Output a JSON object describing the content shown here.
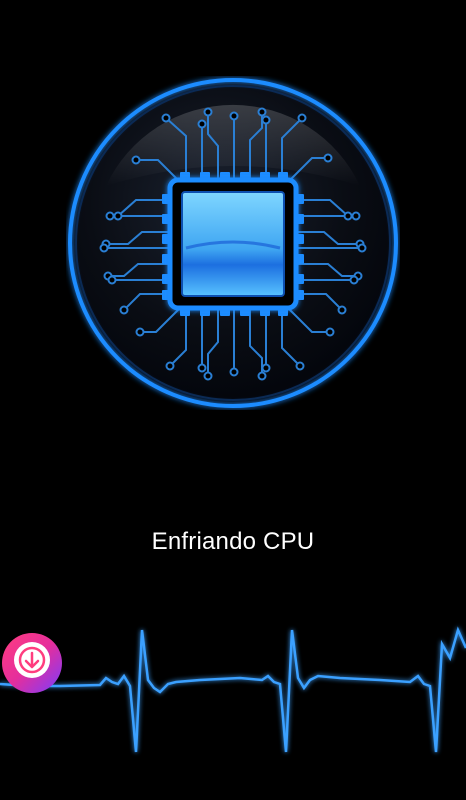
{
  "status": {
    "label": "Enfriando CPU"
  },
  "icons": {
    "chip": "cpu-chip-icon",
    "heartbeat": "heartbeat-wave-icon",
    "download": "download-arrow-icon"
  },
  "colors": {
    "background": "#000000",
    "accent": "#1e8cff",
    "glow": "#3aa0ff",
    "chip_face": "#5cc6ff",
    "text": "#ffffff",
    "fab_start": "#ff3d7f",
    "fab_end": "#7a3cff"
  }
}
